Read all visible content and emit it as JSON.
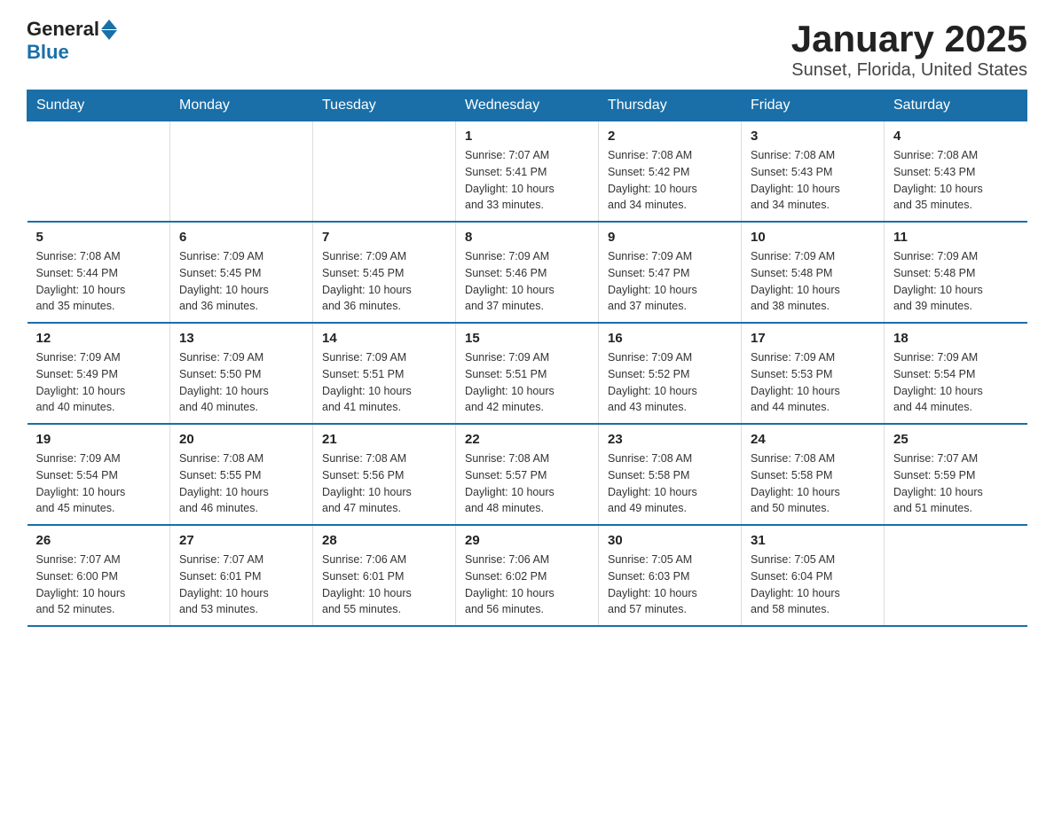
{
  "logo": {
    "general": "General",
    "blue": "Blue"
  },
  "title": "January 2025",
  "subtitle": "Sunset, Florida, United States",
  "days_of_week": [
    "Sunday",
    "Monday",
    "Tuesday",
    "Wednesday",
    "Thursday",
    "Friday",
    "Saturday"
  ],
  "weeks": [
    [
      {
        "day": "",
        "info": ""
      },
      {
        "day": "",
        "info": ""
      },
      {
        "day": "",
        "info": ""
      },
      {
        "day": "1",
        "info": "Sunrise: 7:07 AM\nSunset: 5:41 PM\nDaylight: 10 hours\nand 33 minutes."
      },
      {
        "day": "2",
        "info": "Sunrise: 7:08 AM\nSunset: 5:42 PM\nDaylight: 10 hours\nand 34 minutes."
      },
      {
        "day": "3",
        "info": "Sunrise: 7:08 AM\nSunset: 5:43 PM\nDaylight: 10 hours\nand 34 minutes."
      },
      {
        "day": "4",
        "info": "Sunrise: 7:08 AM\nSunset: 5:43 PM\nDaylight: 10 hours\nand 35 minutes."
      }
    ],
    [
      {
        "day": "5",
        "info": "Sunrise: 7:08 AM\nSunset: 5:44 PM\nDaylight: 10 hours\nand 35 minutes."
      },
      {
        "day": "6",
        "info": "Sunrise: 7:09 AM\nSunset: 5:45 PM\nDaylight: 10 hours\nand 36 minutes."
      },
      {
        "day": "7",
        "info": "Sunrise: 7:09 AM\nSunset: 5:45 PM\nDaylight: 10 hours\nand 36 minutes."
      },
      {
        "day": "8",
        "info": "Sunrise: 7:09 AM\nSunset: 5:46 PM\nDaylight: 10 hours\nand 37 minutes."
      },
      {
        "day": "9",
        "info": "Sunrise: 7:09 AM\nSunset: 5:47 PM\nDaylight: 10 hours\nand 37 minutes."
      },
      {
        "day": "10",
        "info": "Sunrise: 7:09 AM\nSunset: 5:48 PM\nDaylight: 10 hours\nand 38 minutes."
      },
      {
        "day": "11",
        "info": "Sunrise: 7:09 AM\nSunset: 5:48 PM\nDaylight: 10 hours\nand 39 minutes."
      }
    ],
    [
      {
        "day": "12",
        "info": "Sunrise: 7:09 AM\nSunset: 5:49 PM\nDaylight: 10 hours\nand 40 minutes."
      },
      {
        "day": "13",
        "info": "Sunrise: 7:09 AM\nSunset: 5:50 PM\nDaylight: 10 hours\nand 40 minutes."
      },
      {
        "day": "14",
        "info": "Sunrise: 7:09 AM\nSunset: 5:51 PM\nDaylight: 10 hours\nand 41 minutes."
      },
      {
        "day": "15",
        "info": "Sunrise: 7:09 AM\nSunset: 5:51 PM\nDaylight: 10 hours\nand 42 minutes."
      },
      {
        "day": "16",
        "info": "Sunrise: 7:09 AM\nSunset: 5:52 PM\nDaylight: 10 hours\nand 43 minutes."
      },
      {
        "day": "17",
        "info": "Sunrise: 7:09 AM\nSunset: 5:53 PM\nDaylight: 10 hours\nand 44 minutes."
      },
      {
        "day": "18",
        "info": "Sunrise: 7:09 AM\nSunset: 5:54 PM\nDaylight: 10 hours\nand 44 minutes."
      }
    ],
    [
      {
        "day": "19",
        "info": "Sunrise: 7:09 AM\nSunset: 5:54 PM\nDaylight: 10 hours\nand 45 minutes."
      },
      {
        "day": "20",
        "info": "Sunrise: 7:08 AM\nSunset: 5:55 PM\nDaylight: 10 hours\nand 46 minutes."
      },
      {
        "day": "21",
        "info": "Sunrise: 7:08 AM\nSunset: 5:56 PM\nDaylight: 10 hours\nand 47 minutes."
      },
      {
        "day": "22",
        "info": "Sunrise: 7:08 AM\nSunset: 5:57 PM\nDaylight: 10 hours\nand 48 minutes."
      },
      {
        "day": "23",
        "info": "Sunrise: 7:08 AM\nSunset: 5:58 PM\nDaylight: 10 hours\nand 49 minutes."
      },
      {
        "day": "24",
        "info": "Sunrise: 7:08 AM\nSunset: 5:58 PM\nDaylight: 10 hours\nand 50 minutes."
      },
      {
        "day": "25",
        "info": "Sunrise: 7:07 AM\nSunset: 5:59 PM\nDaylight: 10 hours\nand 51 minutes."
      }
    ],
    [
      {
        "day": "26",
        "info": "Sunrise: 7:07 AM\nSunset: 6:00 PM\nDaylight: 10 hours\nand 52 minutes."
      },
      {
        "day": "27",
        "info": "Sunrise: 7:07 AM\nSunset: 6:01 PM\nDaylight: 10 hours\nand 53 minutes."
      },
      {
        "day": "28",
        "info": "Sunrise: 7:06 AM\nSunset: 6:01 PM\nDaylight: 10 hours\nand 55 minutes."
      },
      {
        "day": "29",
        "info": "Sunrise: 7:06 AM\nSunset: 6:02 PM\nDaylight: 10 hours\nand 56 minutes."
      },
      {
        "day": "30",
        "info": "Sunrise: 7:05 AM\nSunset: 6:03 PM\nDaylight: 10 hours\nand 57 minutes."
      },
      {
        "day": "31",
        "info": "Sunrise: 7:05 AM\nSunset: 6:04 PM\nDaylight: 10 hours\nand 58 minutes."
      },
      {
        "day": "",
        "info": ""
      }
    ]
  ]
}
